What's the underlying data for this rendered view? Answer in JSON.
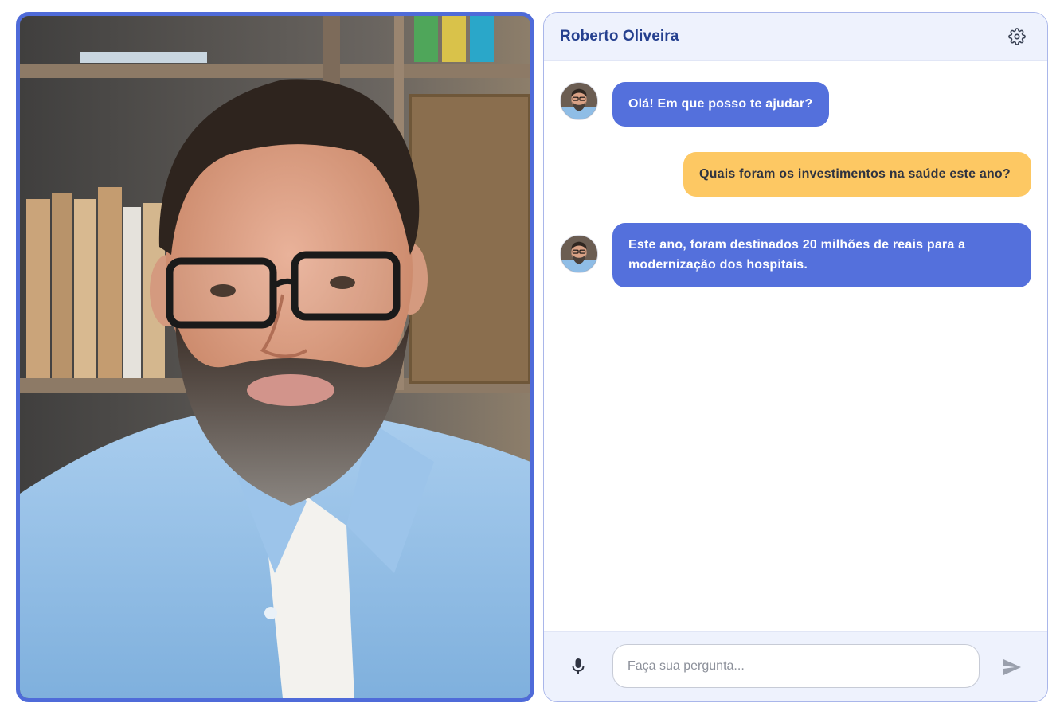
{
  "video": {
    "subject": "Roberto Oliveira video feed"
  },
  "chat": {
    "title": "Roberto Oliveira",
    "settings_icon": "gear-icon",
    "messages": [
      {
        "role": "bot",
        "text": "Olá! Em que posso te ajudar?"
      },
      {
        "role": "user",
        "text": "Quais foram os investimentos na saúde este ano?"
      },
      {
        "role": "bot",
        "text": "Este ano, foram destinados 20 milhões de reais para a modernização dos hospitais."
      }
    ],
    "composer": {
      "mic_icon": "microphone-icon",
      "placeholder": "Faça sua pergunta...",
      "value": "",
      "send_icon": "send-icon"
    }
  },
  "colors": {
    "accent": "#4f6bd9",
    "bot_bubble": "#5470dc",
    "user_bubble": "#fdc863",
    "header_bg": "#eef2fd",
    "title_text": "#25408f"
  }
}
